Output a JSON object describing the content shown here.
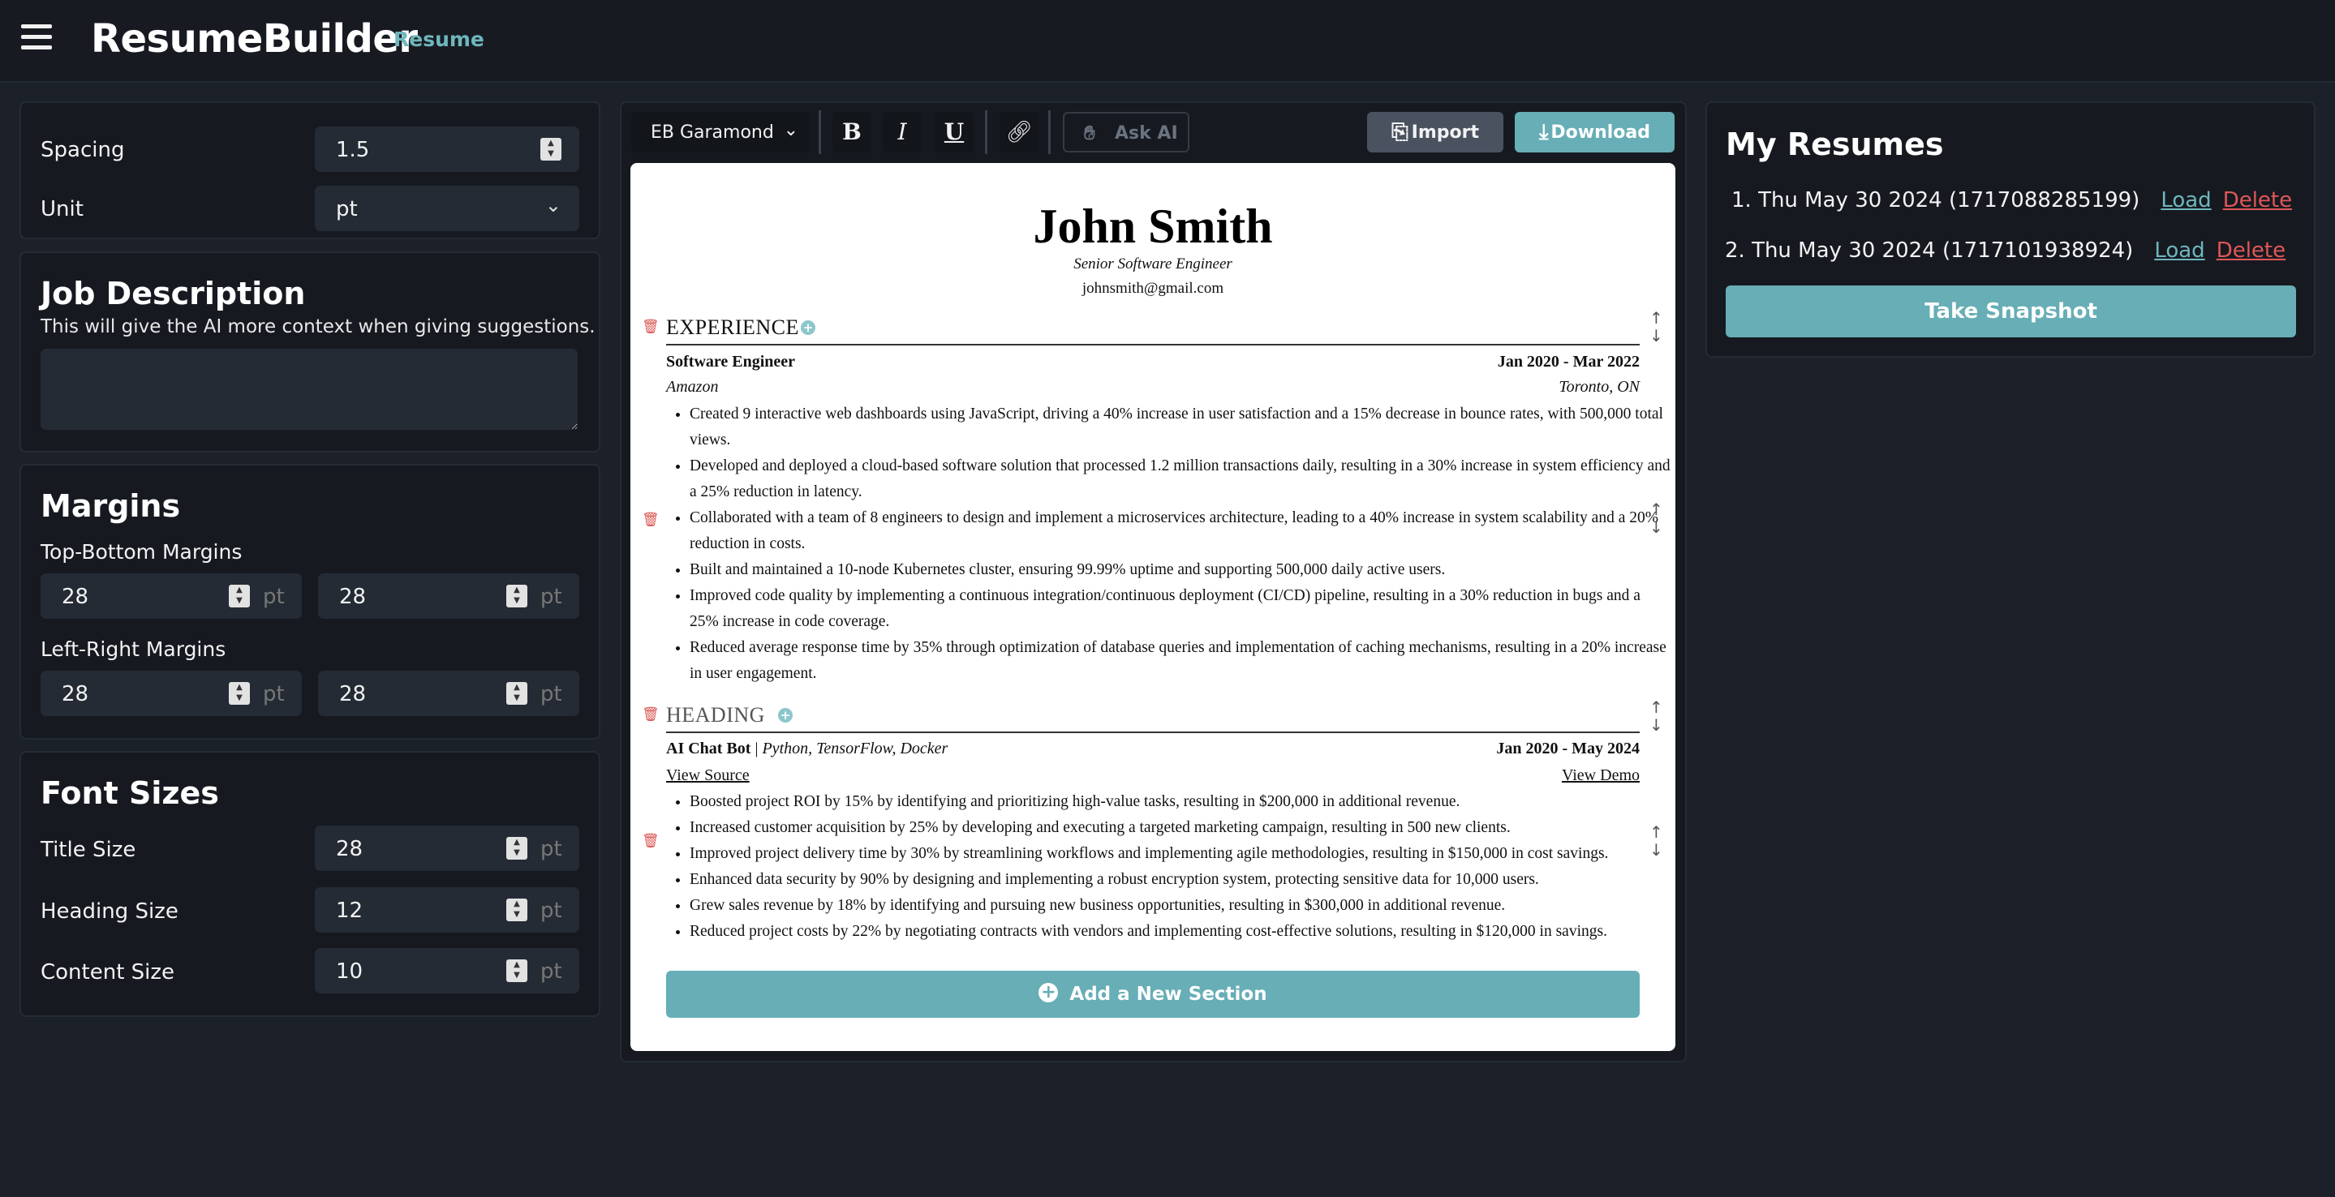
{
  "header": {
    "brand": "ResumeBuilder",
    "nav_link": "Resume"
  },
  "settings": {
    "spacing": {
      "label": "Spacing",
      "value": "1.5"
    },
    "unit": {
      "label": "Unit",
      "value": "pt"
    }
  },
  "job_description": {
    "title": "Job Description",
    "subtitle": "This will give the AI more context when giving suggestions.",
    "value": ""
  },
  "margins": {
    "title": "Margins",
    "top_bottom_label": "Top-Bottom Margins",
    "top": "28",
    "bottom": "28",
    "left_right_label": "Left-Right Margins",
    "left": "28",
    "right": "28",
    "unit": "pt"
  },
  "font_sizes": {
    "title": "Font Sizes",
    "title_size_label": "Title Size",
    "title_size": "28",
    "heading_size_label": "Heading Size",
    "heading_size": "12",
    "content_size_label": "Content Size",
    "content_size": "10",
    "unit": "pt"
  },
  "toolbar": {
    "font": "EB Garamond",
    "bold": "B",
    "italic": "I",
    "underline": "U",
    "ask_ai": "Ask AI",
    "import": "Import",
    "download": "Download"
  },
  "resume": {
    "name": "John Smith",
    "title": "Senior Software Engineer",
    "email": "johnsmith@gmail.com",
    "experience": {
      "heading": "EXPERIENCE",
      "role": "Software Engineer",
      "dates": "Jan 2020 - Mar 2022",
      "company": "Amazon",
      "location": "Toronto, ON",
      "bullets": [
        "Created 9 interactive web dashboards using JavaScript, driving a 40% increase in user satisfaction and a 15% decrease in bounce rates, with 500,000 total views.",
        "Developed and deployed a cloud-based software solution that processed 1.2 million transactions daily, resulting in a 30% increase in system efficiency and a 25% reduction in latency.",
        "Collaborated with a team of 8 engineers to design and implement a microservices architecture, leading to a 40% increase in system scalability and a 20% reduction in costs.",
        "Built and maintained a 10-node Kubernetes cluster, ensuring 99.99% uptime and supporting 500,000 daily active users.",
        "Improved code quality by implementing a continuous integration/continuous deployment (CI/CD) pipeline, resulting in a 30% reduction in bugs and a 25% increase in code coverage.",
        "Reduced average response time by 35% through optimization of database queries and implementation of caching mechanisms, resulting in a 20% increase in user engagement."
      ]
    },
    "project": {
      "heading": "HEADING",
      "name": "AI Chat Bot",
      "separator": " | ",
      "tech": "Python, TensorFlow, Docker",
      "dates": "Jan 2020 - May 2024",
      "source_link": "View Source",
      "demo_link": "View Demo",
      "bullets": [
        "Boosted project ROI by 15% by identifying and prioritizing high-value tasks, resulting in $200,000 in additional revenue.",
        "Increased customer acquisition by 25% by developing and executing a targeted marketing campaign, resulting in 500 new clients.",
        "Improved project delivery time by 30% by streamlining workflows and implementing agile methodologies, resulting in $150,000 in cost savings.",
        "Enhanced data security by 90% by designing and implementing a robust encryption system, protecting sensitive data for 10,000 users.",
        "Grew sales revenue by 18% by identifying and pursuing new business opportunities, resulting in $300,000 in additional revenue.",
        "Reduced project costs by 22% by negotiating contracts with vendors and implementing cost-effective solutions, resulting in $120,000 in savings."
      ]
    },
    "add_section": "Add a New Section"
  },
  "my_resumes": {
    "title": "My Resumes",
    "items": [
      {
        "label": "1. Thu May 30 2024 (1717088285199)",
        "load": "Load",
        "delete": "Delete"
      },
      {
        "label": "2. Thu May 30 2024 (1717101938924)",
        "load": "Load",
        "delete": "Delete"
      }
    ],
    "snapshot": "Take Snapshot"
  }
}
